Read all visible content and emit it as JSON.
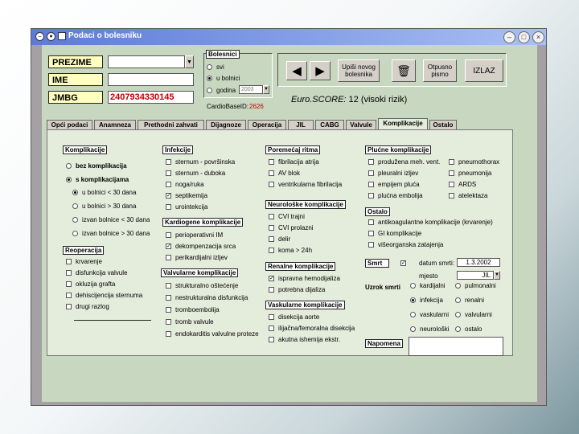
{
  "window": {
    "title": "Podaci o bolesniku"
  },
  "patient": {
    "prezime_label": "PREZIME",
    "ime_label": "IME",
    "jmbg_label": "JMBG",
    "prezime_value": "",
    "ime_value": "",
    "jmbg_value": "2407934330145"
  },
  "bolesnici": {
    "title": "Bolesnici",
    "options": [
      "svi",
      "u bolnici",
      "godina"
    ],
    "year_value": "2003",
    "cardiobase_label": "CardioBaseID:",
    "cardiobase_value": "2626"
  },
  "toolbar": {
    "new_patient": "Upiši novog bolesnika",
    "print": "Otpusno pismo",
    "exit": "IZLAZ"
  },
  "euroscore": {
    "label": "Euro.SCORE:",
    "value": "12 (visoki rizik)"
  },
  "tabs": [
    "Opći podaci",
    "Anamneza",
    "Prethodni zahvati",
    "Dijagnoze",
    "Operacija",
    "JIL",
    "CABG",
    "Valvule",
    "Komplikacije",
    "Ostalo"
  ],
  "komplikacije": {
    "title": "Komplikacije",
    "options": [
      "bez komplikacija",
      "s komplikacijama"
    ],
    "sub_options": [
      "u bolnici < 30 dana",
      "u bolnici > 30 dana",
      "izvan bolnice < 30 dana",
      "izvan bolnice > 30 dana"
    ]
  },
  "reoperacija": {
    "title": "Reoperacija",
    "items": [
      "krvarenje",
      "disfunkcija valvule",
      "okluzija grafta",
      "dehiscijencija sternuma",
      "drugi razlog"
    ]
  },
  "infekcije": {
    "title": "Infekcije",
    "items": [
      "sternum - površinska",
      "sternum - duboka",
      "noga/ruka",
      "septikemija",
      "urointekcija"
    ]
  },
  "kardiogene": {
    "title": "Kardiogene komplikacije",
    "items": [
      "perioperativni IM",
      "dekompenzacija srca",
      "perikardijalni izljev"
    ]
  },
  "valvularne": {
    "title": "Valvularne komplikacije",
    "items": [
      "strukturalno oštećenje",
      "nestrukturalna disfunkcija",
      "tromboembolija",
      "tromb valvule",
      "endokarditis valvulne proteze"
    ]
  },
  "premjestaj": {
    "title": "Poremećaj ritma",
    "items": [
      "fibrilacija atrija",
      "AV blok",
      "ventrikularna fibrilacija"
    ]
  },
  "neuroloske": {
    "title": "Neurološke komplikacije",
    "items": [
      "CVI trajni",
      "CVI prolazni",
      "delir",
      "koma > 24h"
    ]
  },
  "renalne": {
    "title": "Renalne komplikacije",
    "items": [
      "ispravna hemodijaliza",
      "potrebna dijaliza"
    ]
  },
  "vaskularne": {
    "title": "Vaskularne komplikacije",
    "items": [
      "disekcija aorte",
      "ilijačna/femoralna disekcija",
      "akutna ishemija ekstr."
    ]
  },
  "plucne": {
    "title": "Plućne komplikacije",
    "col1": [
      "produžena meh. vent.",
      "pleuralni izljev",
      "empijem pluća",
      "plućna embolija"
    ],
    "col2": [
      "pneumothorax",
      "pneumonija",
      "ARDS",
      "atelektaza"
    ]
  },
  "ostalo": {
    "title": "Ostalo",
    "items": [
      "antikoagulantne komplikacije (krvarenje)",
      "GI komplikacije",
      "višeorganska zatajenja"
    ]
  },
  "smrt": {
    "title": "Smrt",
    "datum_label": "datum smrti:",
    "datum_value": "1.3.2002",
    "mjesto_label": "mjesto",
    "mjesto_value": "JIL",
    "uzrok_label": "Uzrok smrti",
    "uzrok_col1": [
      "kardijalni",
      "infekcija",
      "vaskularni",
      "neurološki"
    ],
    "uzrok_col2": [
      "pulmonalni",
      "renalni",
      "valvularni",
      "ostalo"
    ]
  },
  "napomena": {
    "title": "Napomena",
    "value": ""
  }
}
